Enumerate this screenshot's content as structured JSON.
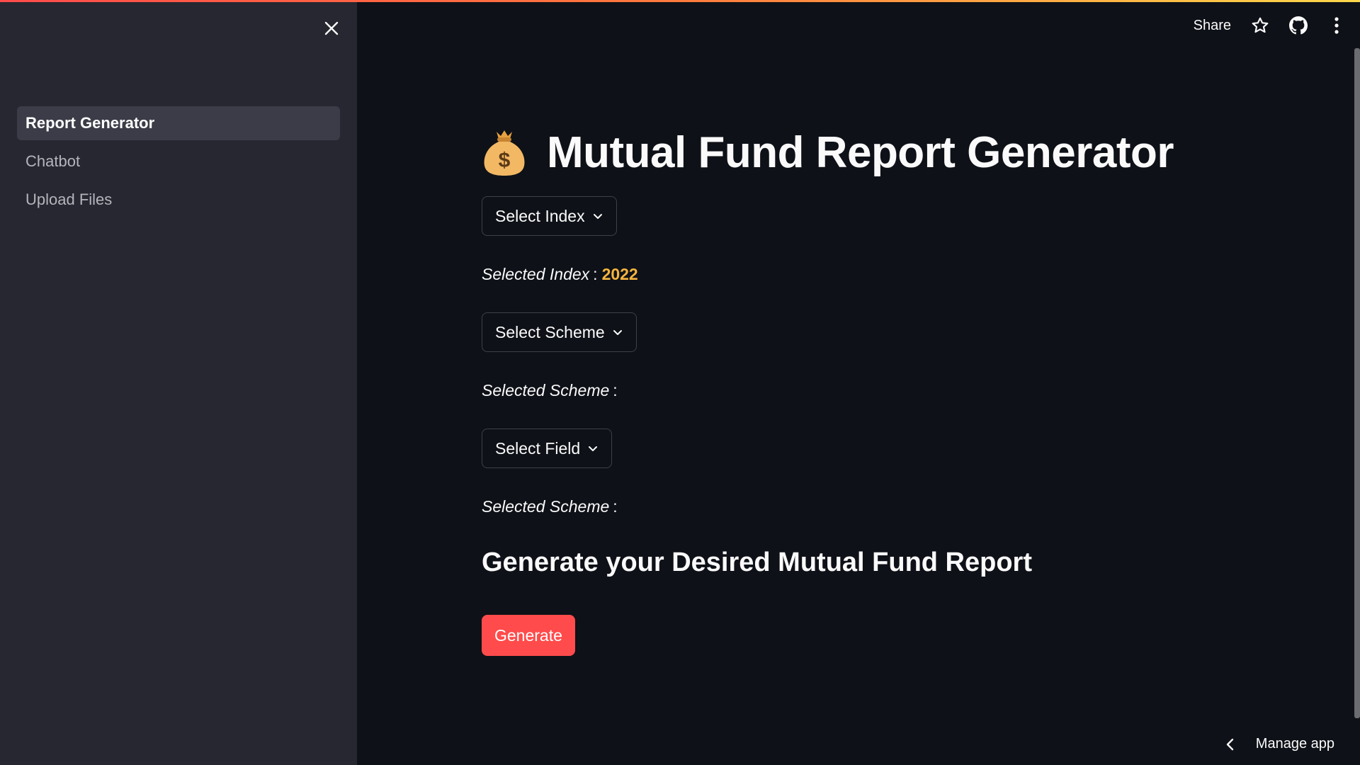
{
  "sidebar": {
    "items": [
      {
        "label": "Report Generator",
        "active": true
      },
      {
        "label": "Chatbot",
        "active": false
      },
      {
        "label": "Upload Files",
        "active": false
      }
    ]
  },
  "toolbar": {
    "share_label": "Share",
    "icons": [
      "star-icon",
      "github-icon",
      "more-vertical-icon"
    ]
  },
  "main": {
    "title_icon": "money-bag-icon",
    "title": "Mutual Fund Report Generator",
    "index_select": {
      "label": "Select Index"
    },
    "selected_index": {
      "label": "Selected Index",
      "separator": ":",
      "value": "2022"
    },
    "scheme_select": {
      "label": "Select Scheme"
    },
    "selected_scheme": {
      "label": "Selected Scheme",
      "separator": ":",
      "value": ""
    },
    "field_select": {
      "label": "Select Field"
    },
    "selected_field": {
      "label": "Selected Scheme",
      "separator": ":",
      "value": ""
    },
    "subheading": "Generate your Desired Mutual Fund Report",
    "generate_label": "Generate"
  },
  "footer": {
    "manage_label": "Manage app"
  },
  "colors": {
    "background": "#0e1117",
    "sidebar": "#262730",
    "primary": "#ff4b4b",
    "highlight_value": "#f5b43f"
  }
}
